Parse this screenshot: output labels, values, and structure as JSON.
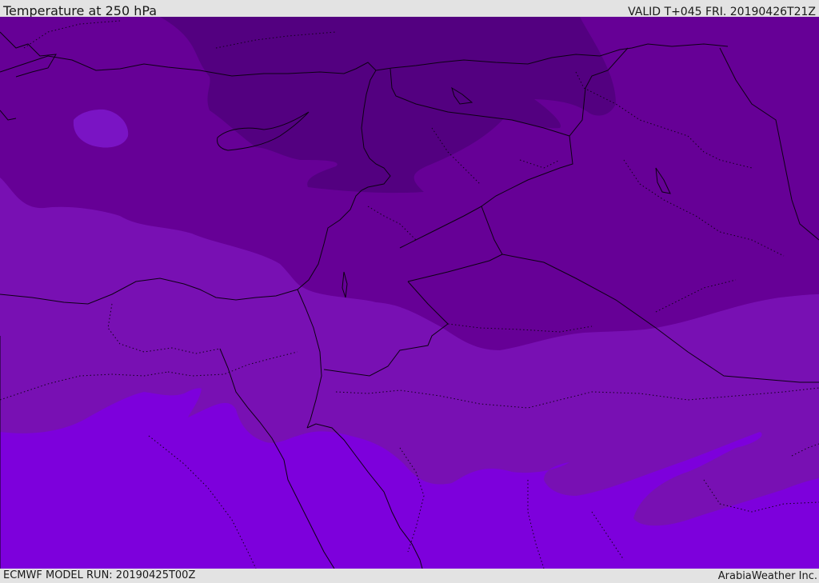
{
  "header": {
    "title": "Temperature at 250 hPa",
    "valid": "VALID T+045 FRI. 20190426T21Z"
  },
  "footer": {
    "model_run": "ECMWF MODEL RUN: 20190425T00Z",
    "credit": "ArabiaWeather Inc."
  },
  "map": {
    "field": "Temperature at 250 hPa",
    "shading_colors": {
      "coldest": "#530080",
      "cold": "#660096",
      "mid": "#7810b3",
      "warm": "#7d00dc",
      "warm_patch": "#7a14c4"
    },
    "coastline_color": "#0d0014",
    "border_style": "dotted"
  }
}
